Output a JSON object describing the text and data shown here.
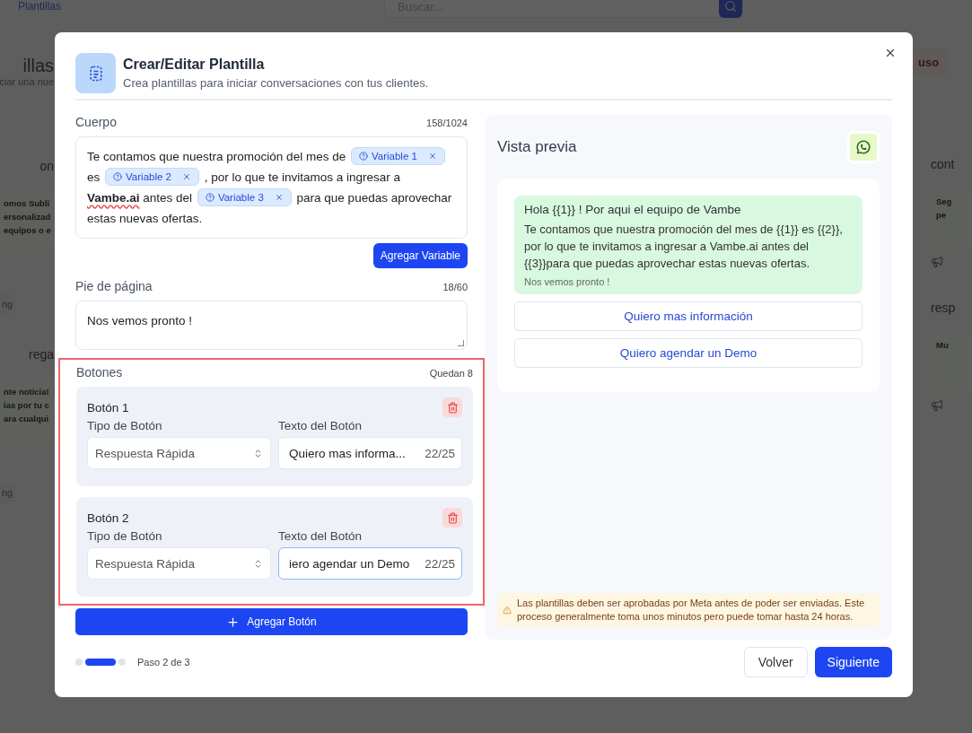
{
  "background": {
    "breadcrumb": "Plantillas",
    "search_placeholder": "Buscar...",
    "page_title": "illas",
    "page_subtitle": "ciar una nue",
    "action_button": "uso",
    "left_cards": [
      {
        "title": "on",
        "lines": [
          "omos Subli",
          "ersonalizad",
          "equipos o e"
        ],
        "tag": "ng"
      },
      {
        "title": "rega",
        "lines": [
          "nte noticia!",
          "ias por tu c",
          "ara cualqui"
        ],
        "tag": "ng"
      }
    ],
    "right_cards": [
      {
        "title": "cont",
        "lines": [
          "Seg",
          "pe"
        ]
      },
      {
        "title": "resp",
        "lines": [
          "Mu"
        ]
      }
    ]
  },
  "modal": {
    "title": "Crear/Editar Plantilla",
    "subtitle": "Crea plantillas para iniciar conversaciones con tus clientes.",
    "body": {
      "label": "Cuerpo",
      "count": "158/1024",
      "segments": [
        {
          "kind": "text",
          "text": "Te contamos que nuestra promoción del mes de"
        },
        {
          "kind": "variable",
          "label": "Variable 1"
        },
        {
          "kind": "text",
          "text": "es"
        },
        {
          "kind": "variable",
          "label": "Variable 2"
        },
        {
          "kind": "text",
          "text": ", por lo que te invitamos a ingresar a"
        },
        {
          "kind": "link",
          "text": "Vambe.ai"
        },
        {
          "kind": "text",
          "text": "antes del"
        },
        {
          "kind": "variable",
          "label": "Variable 3"
        },
        {
          "kind": "text",
          "text": "para que puedas aprovechar estas nuevas ofertas."
        }
      ],
      "add_variable": "Agregar Variable"
    },
    "footer": {
      "label": "Pie de página",
      "count": "18/60",
      "value": "Nos vemos pronto !"
    },
    "buttons_section": {
      "label": "Botones",
      "remaining": "Quedan 8",
      "highlighted": true,
      "items": [
        {
          "title": "Botón 1",
          "type_label": "Tipo de Botón",
          "type_value": "Respuesta Rápida",
          "text_label": "Texto del Botón",
          "text_value": "Quiero mas informa...",
          "count": "22/25",
          "focused": false
        },
        {
          "title": "Botón 2",
          "type_label": "Tipo de Botón",
          "type_value": "Respuesta Rápida",
          "text_label": "Texto del Botón",
          "text_value": "iero agendar un Demo",
          "count": "22/25",
          "focused": true
        }
      ],
      "add_button": "Agregar Botón"
    },
    "steps": [
      {
        "selected": false
      },
      {
        "selected": true
      },
      {
        "selected": false
      }
    ],
    "step_label": "Paso 2 de 3",
    "preview": {
      "title": "Vista previa",
      "header": "Hola {{1}} ! Por aqui el equipo de Vambe",
      "body": "Te contamos que nuestra promoción del mes de {{1}} es {{2}}, por lo que te invitamos a ingresar a Vambe.ai antes del {{3}}para que puedas aprovechar estas nuevas ofertas.",
      "footer": "Nos vemos pronto !",
      "buttons": [
        "Quiero mas información",
        "Quiero agendar un Demo"
      ],
      "notice": "Las plantillas deben ser aprobadas por Meta antes de poder ser enviadas. Este proceso generalmente toma unos minutos pero puede tomar hasta 24 horas."
    },
    "back": "Volver",
    "next": "Siguiente"
  }
}
